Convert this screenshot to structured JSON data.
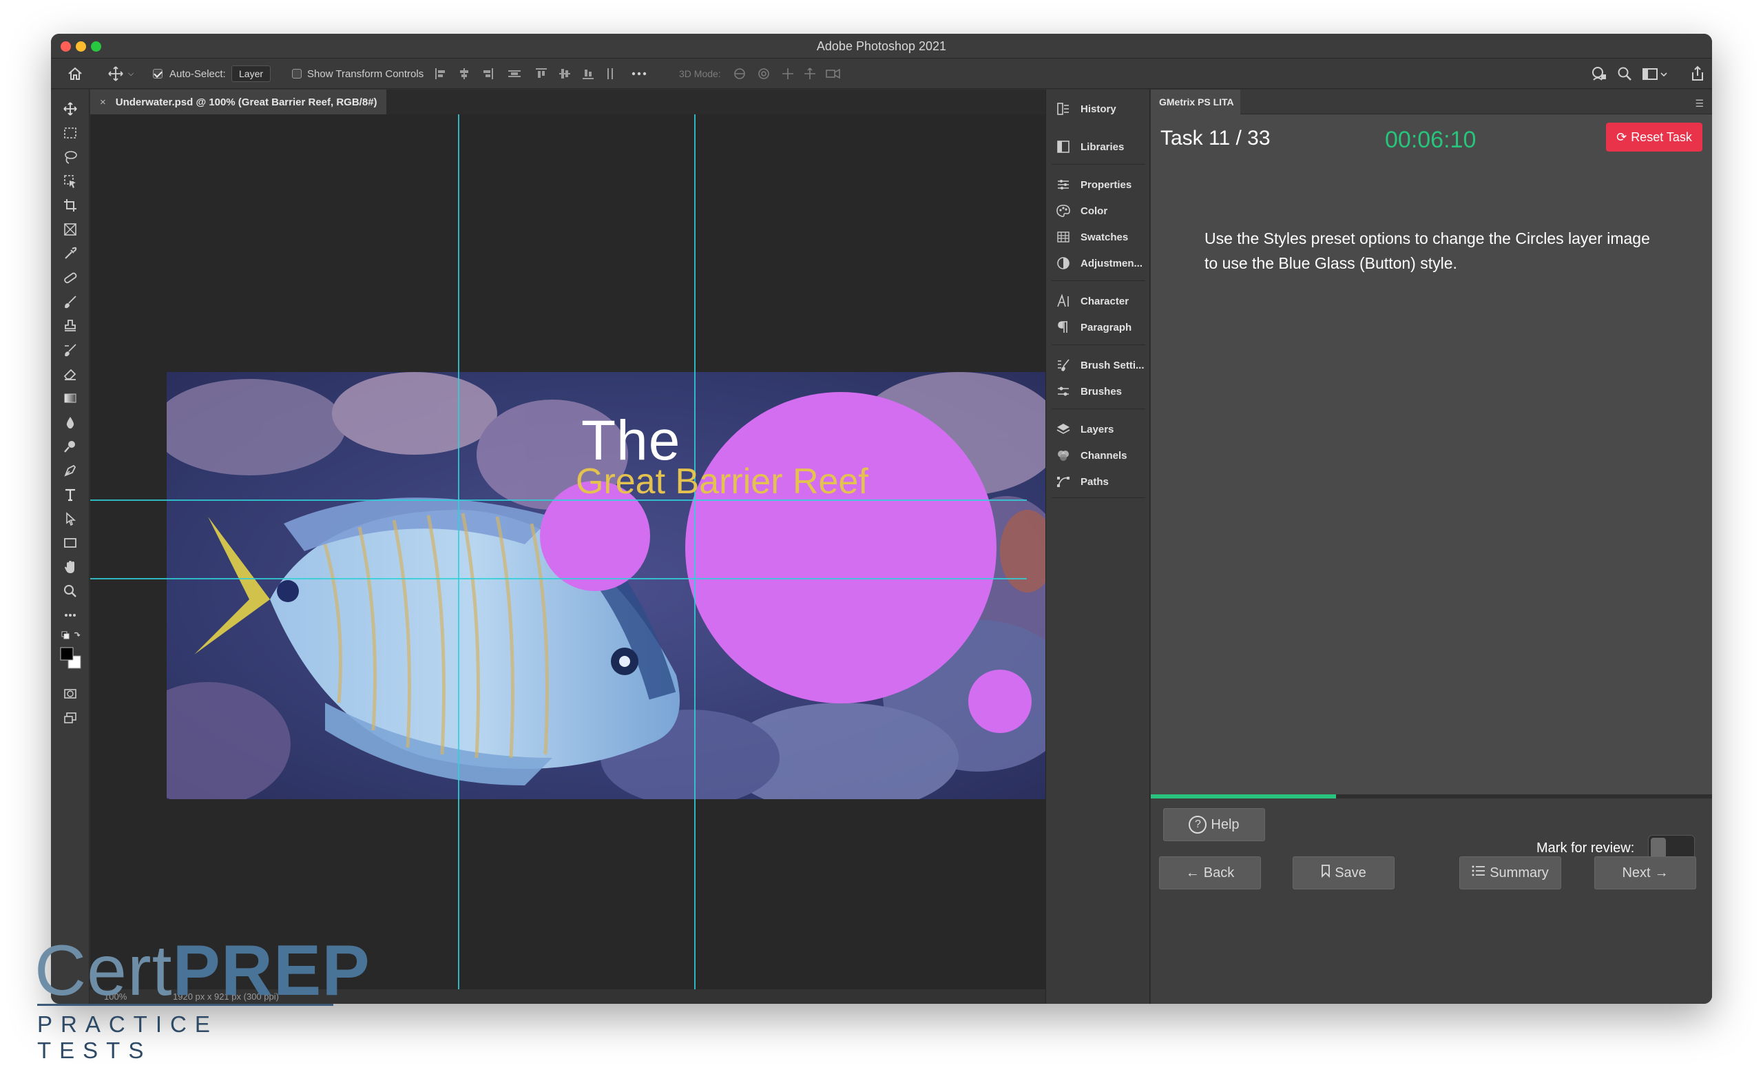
{
  "window": {
    "title": "Adobe Photoshop 2021"
  },
  "options_bar": {
    "auto_select_label": "Auto-Select:",
    "auto_select_value": "Layer",
    "show_transform_label": "Show Transform Controls",
    "three_d_label": "3D Mode:"
  },
  "document": {
    "tab_title": "Underwater.psd @ 100% (Great Barrier Reef, RGB/8#)",
    "text_the": "The",
    "text_reef": "Great Barrier Reef",
    "zoom": "100%",
    "dimensions": "1920 px x 921 px (300 ppi)"
  },
  "panels": {
    "items": [
      "History",
      "Libraries",
      "Properties",
      "Color",
      "Swatches",
      "Adjustmen...",
      "Character",
      "Paragraph",
      "Brush Setti...",
      "Brushes",
      "Layers",
      "Channels",
      "Paths"
    ]
  },
  "gmetrix": {
    "tab": "GMetrix PS LITA",
    "task": "Task 11 / 33",
    "timer": "00:06:10",
    "reset_label": "Reset Task",
    "instructions": "Use the Styles preset options to change the Circles layer image to use the Blue Glass (Button) style.",
    "progress": 0.33,
    "help_label": "Help",
    "mark_label": "Mark for review:",
    "back_label": "Back",
    "save_label": "Save",
    "summary_label": "Summary",
    "next_label": "Next"
  },
  "logo": {
    "cert": "Cert",
    "prep": "PREP",
    "tagline": "PRACTICE TESTS"
  },
  "colors": {
    "circle": "#d36ef0",
    "guide": "#2fd0d8",
    "timer": "#27c47c",
    "reset": "#e8334a",
    "headline_reef": "#e3c24f"
  }
}
